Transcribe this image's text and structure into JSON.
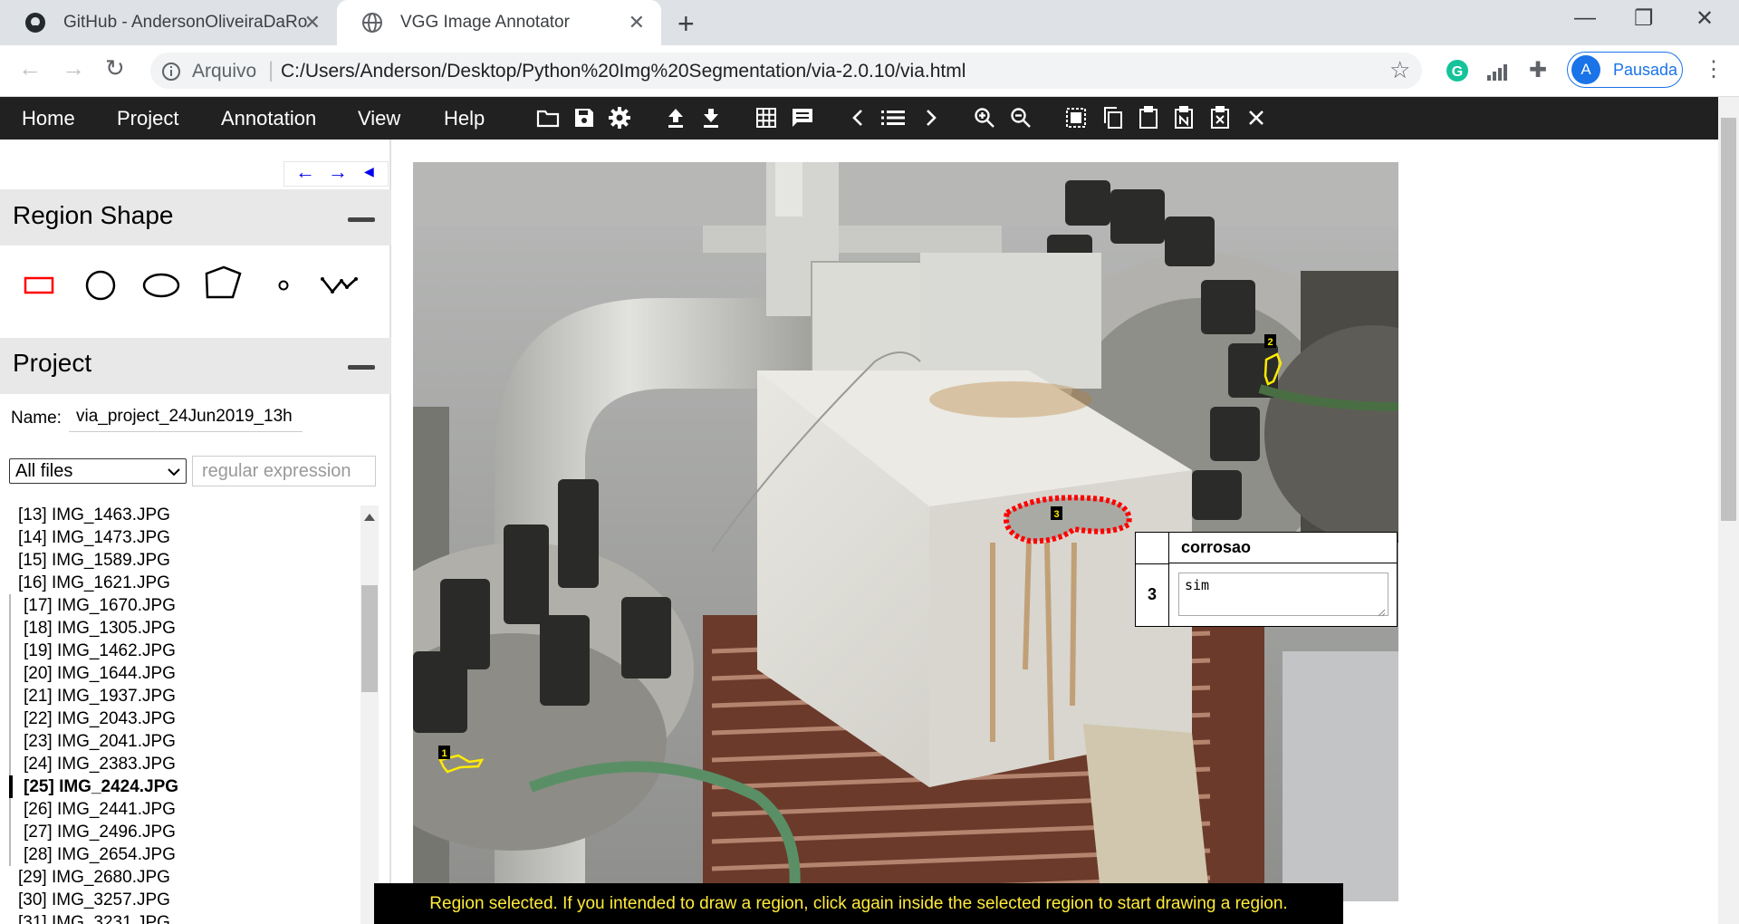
{
  "browser": {
    "tabs": [
      {
        "title": "GitHub - AndersonOliveiraDaRoc",
        "icon": "github-icon"
      },
      {
        "title": "VGG Image Annotator",
        "icon": "globe-icon"
      }
    ],
    "address_prefix": "Arquivo",
    "url": "C:/Users/Anderson/Desktop/Python%20Img%20Segmentation/via-2.0.10/via.html",
    "profile_initial": "A",
    "profile_label": "Pausada"
  },
  "menubar": {
    "items": [
      "Home",
      "Project",
      "Annotation",
      "View",
      "Help"
    ]
  },
  "left_panel": {
    "region_shape_title": "Region Shape",
    "project_title": "Project",
    "name_label": "Name:",
    "project_name": "via_project_24Jun2019_13h",
    "filter_selected": "All files",
    "regex_placeholder": "regular expression",
    "files": [
      "[13] IMG_1463.JPG",
      "[14] IMG_1473.JPG",
      "[15] IMG_1589.JPG",
      "[16] IMG_1621.JPG",
      "[17] IMG_1670.JPG",
      "[18] IMG_1305.JPG",
      "[19] IMG_1462.JPG",
      "[20] IMG_1644.JPG",
      "[21] IMG_1937.JPG",
      "[22] IMG_2043.JPG",
      "[23] IMG_2041.JPG",
      "[24] IMG_2383.JPG",
      "[25] IMG_2424.JPG",
      "[26] IMG_2441.JPG",
      "[27] IMG_2496.JPG",
      "[28] IMG_2654.JPG",
      "[29] IMG_2680.JPG",
      "[30] IMG_3257.JPG",
      "[31] IMG_3231.JPG"
    ]
  },
  "annotation": {
    "region_labels": [
      "1",
      "2",
      "3"
    ],
    "attr_header": "corrosao",
    "region_id": "3",
    "attr_value": "sim"
  },
  "status": "Region selected. If you intended to draw a region, click again inside the selected region to start drawing a region.",
  "colors": {
    "menubar": "#212121",
    "selected_region": "#ff0000",
    "region": "#ffeb00",
    "status_text": "#ffeb3b"
  }
}
